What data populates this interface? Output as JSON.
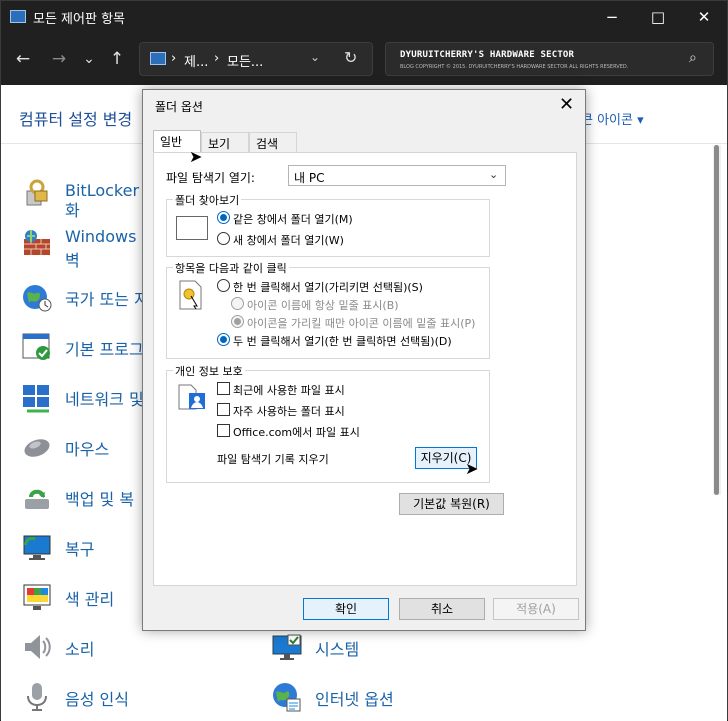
{
  "window": {
    "title": "모든 제어판 항목",
    "minimize": "−",
    "maximize": "□",
    "close": "✕"
  },
  "nav": {
    "back": "←",
    "forward": "→",
    "recent": "⌄",
    "up": "↑",
    "breadcrumb": [
      "제...",
      "모든..."
    ],
    "breadcrumb_sep": "›",
    "refresh": "↻",
    "dropdown": "⌄",
    "search_watermark_line1": "DYURUITCHERRY'S HARDWARE SECTOR",
    "search_watermark_line2": "BLOG COPYRIGHT © 2015. DYURUITCHERRY'S HARDWARE SECTOR ALL RIGHTS RESERVED."
  },
  "content": {
    "heading": "컴퓨터 설정 변경",
    "view_by": "큰 아이콘 ▾",
    "items_left": [
      {
        "label": "BitLocker 드",
        "label2": "화",
        "icon": "bitlocker-icon"
      },
      {
        "label": "Windows D",
        "label2": "벽",
        "icon": "firewall-icon"
      },
      {
        "label": "국가 또는 지",
        "icon": "region-icon"
      },
      {
        "label": "기본 프로그",
        "icon": "default-programs-icon"
      },
      {
        "label": "네트워크 및",
        "icon": "network-icon"
      },
      {
        "label": "마우스",
        "icon": "mouse-icon"
      },
      {
        "label": "백업 및 복",
        "icon": "backup-icon"
      },
      {
        "label": "복구",
        "icon": "recovery-icon"
      },
      {
        "label": "색 관리",
        "icon": "color-management-icon"
      },
      {
        "label": "소리",
        "icon": "sound-icon"
      },
      {
        "label": "음성 인식",
        "icon": "speech-icon"
      }
    ],
    "items_right": [
      {
        "label": "시스템",
        "icon": "system-icon"
      },
      {
        "label": "인터넷 옵션",
        "icon": "internet-options-icon"
      }
    ]
  },
  "dialog": {
    "title": "폴더 옵션",
    "close": "✕",
    "tabs": [
      "일반",
      "보기",
      "검색"
    ],
    "open_explorer_label": "파일 탐색기 열기:",
    "open_explorer_value": "내 PC",
    "browse_group": {
      "legend": "폴더 찾아보기",
      "options": [
        "같은 창에서 폴더 열기(M)",
        "새 창에서 폴더 열기(W)"
      ],
      "selected": 0
    },
    "click_group": {
      "legend": "항목을 다음과 같이 클릭",
      "single": "한 번 클릭해서 열기(가리키면 선택됨)(S)",
      "sub_always": "아이콘 이름에 항상 밑줄 표시(B)",
      "sub_hover": "아이콘을 가리킬 때만 아이콘 이름에 밑줄 표시(P)",
      "double": "두 번 클릭해서 열기(한 번 클릭하면 선택됨)(D)",
      "selected": "double"
    },
    "privacy_group": {
      "legend": "개인 정보 보호",
      "checks": [
        "최근에 사용한 파일 표시",
        "자주 사용하는 폴더 표시",
        "Office.com에서 파일 표시"
      ],
      "clear_label": "파일 탐색기 기록 지우기",
      "clear_button": "지우기(C)"
    },
    "restore_defaults": "기본값 복원(R)",
    "ok": "확인",
    "cancel": "취소",
    "apply": "적용(A)"
  }
}
